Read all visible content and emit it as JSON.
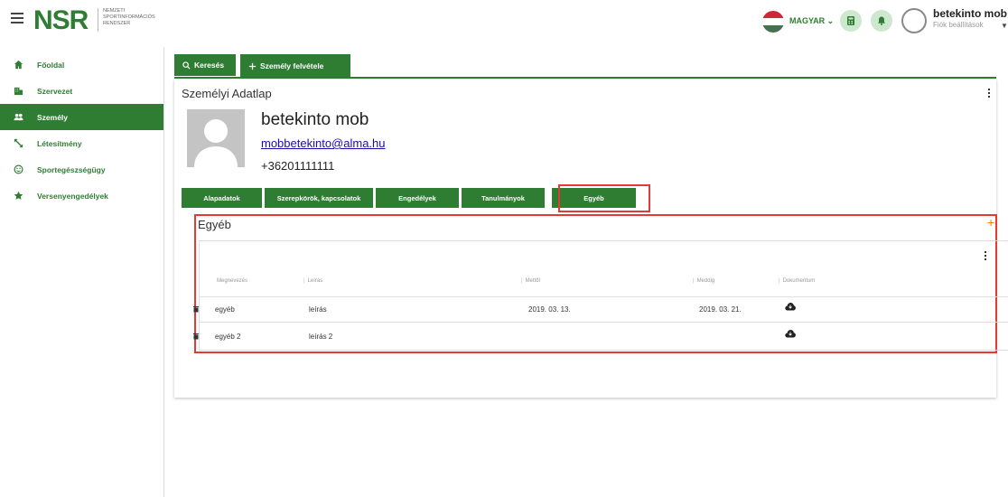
{
  "header": {
    "logo": "NSR",
    "logo_sub_1": "Nemzeti",
    "logo_sub_2": "Sportinformációs",
    "logo_sub_3": "Rendszer",
    "language": "MAGYAR ⌄",
    "user_name": "betekinto mob",
    "user_sub": "Fiók beállítások"
  },
  "sidebar": {
    "items": [
      {
        "label": "Főoldal",
        "icon": "home-icon"
      },
      {
        "label": "Szervezet",
        "icon": "building-icon"
      },
      {
        "label": "Személy",
        "icon": "people-icon"
      },
      {
        "label": "Létesítmény",
        "icon": "arrows-icon"
      },
      {
        "label": "Sportegészségügy",
        "icon": "smile-icon"
      },
      {
        "label": "Versenyengedélyek",
        "icon": "star-icon"
      }
    ],
    "active_index": 2
  },
  "top_tabs": {
    "search": "Keresés",
    "add_person": "Személy felvétele"
  },
  "card": {
    "title": "Személyi Adatlap",
    "person_name": "betekinto mob",
    "email": "mobbetekinto@alma.hu",
    "phone": "+36201111111"
  },
  "sub_tabs": [
    "Alapadatok",
    "Szerepkörök, kapcsolatok",
    "Engedélyek",
    "Tanulmányok",
    "Egyéb"
  ],
  "active_sub_tab": "Egyéb",
  "section": {
    "title": "Egyéb",
    "add_symbol": "+"
  },
  "table": {
    "columns": [
      "Megnevezés",
      "Leírás",
      "Mettől",
      "Meddig",
      "Dokumentum"
    ],
    "rows": [
      {
        "name": "egyéb",
        "desc": "leírás",
        "from": "2019. 03. 13.",
        "to": "2019. 03. 21."
      },
      {
        "name": "egyéb 2",
        "desc": "leírás 2",
        "from": "",
        "to": ""
      }
    ]
  },
  "colors": {
    "brand_green": "#2e7d32",
    "highlight_red": "#e53935",
    "accent_orange": "#f57c00"
  }
}
